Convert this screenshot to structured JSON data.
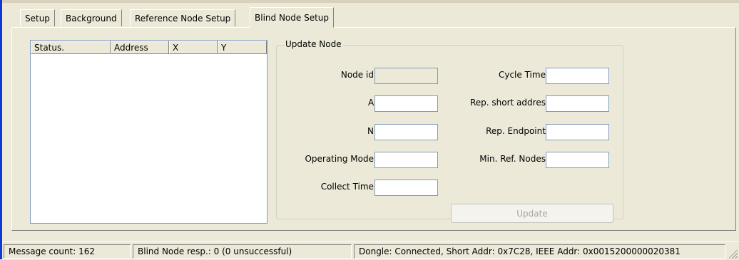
{
  "tabs": [
    {
      "label": "Setup",
      "active": false
    },
    {
      "label": "Background",
      "active": false
    },
    {
      "label": "Reference Node Setup",
      "active": false
    },
    {
      "label": "Blind Node Setup",
      "active": true
    }
  ],
  "listview": {
    "columns": [
      "Status.",
      "Address",
      "X",
      "Y"
    ],
    "rows": []
  },
  "update_node": {
    "title": "Update Node",
    "left_fields": [
      {
        "label": "Node id:",
        "value": "",
        "disabled": true
      },
      {
        "label": "A:",
        "value": ""
      },
      {
        "label": "N:",
        "value": ""
      },
      {
        "label": "Operating Mode:",
        "value": ""
      },
      {
        "label": "Collect Time:",
        "value": ""
      }
    ],
    "right_fields": [
      {
        "label": "Cycle Time:",
        "value": ""
      },
      {
        "label": "Rep. short addres:",
        "value": ""
      },
      {
        "label": "Rep. Endpoint:",
        "value": ""
      },
      {
        "label": "Min. Ref. Nodes:",
        "value": ""
      }
    ],
    "update_button": {
      "label": "Update",
      "enabled": false
    }
  },
  "statusbar": {
    "message_count": "Message count: 162",
    "blind_node_resp": "Blind Node resp.: 0 (0 unsuccessful)",
    "dongle": "Dongle: Connected, Short Addr: 0x7C28, IEEE Addr: 0x0015200000020381"
  }
}
